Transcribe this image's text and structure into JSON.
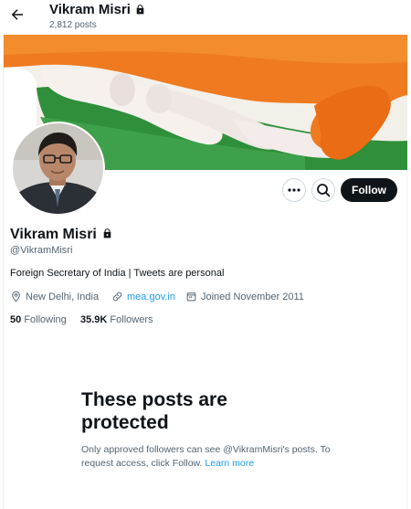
{
  "header": {
    "name": "Vikram Misri",
    "posts": "2,812 posts"
  },
  "actions": {
    "follow_label": "Follow"
  },
  "profile": {
    "name": "Vikram Misri",
    "handle": "@VikramMisri",
    "bio": "Foreign Secretary of India | Tweets are personal",
    "location": "New Delhi, India",
    "website": "mea.gov.in",
    "joined": "Joined November 2011",
    "following_count": "50",
    "following_label": "Following",
    "followers_count": "35.9K",
    "followers_label": "Followers"
  },
  "protected": {
    "title": "These posts are protected",
    "text": "Only approved followers can see @VikramMisri's posts. To request access, click Follow.",
    "link": "Learn more"
  },
  "colors": {
    "accent": "#1d9bf0",
    "follow_bg": "#0f1419",
    "muted": "#536471"
  },
  "icons": [
    "back-arrow-icon",
    "lock-icon",
    "more-icon",
    "search-icon",
    "location-icon",
    "link-icon",
    "calendar-icon"
  ]
}
